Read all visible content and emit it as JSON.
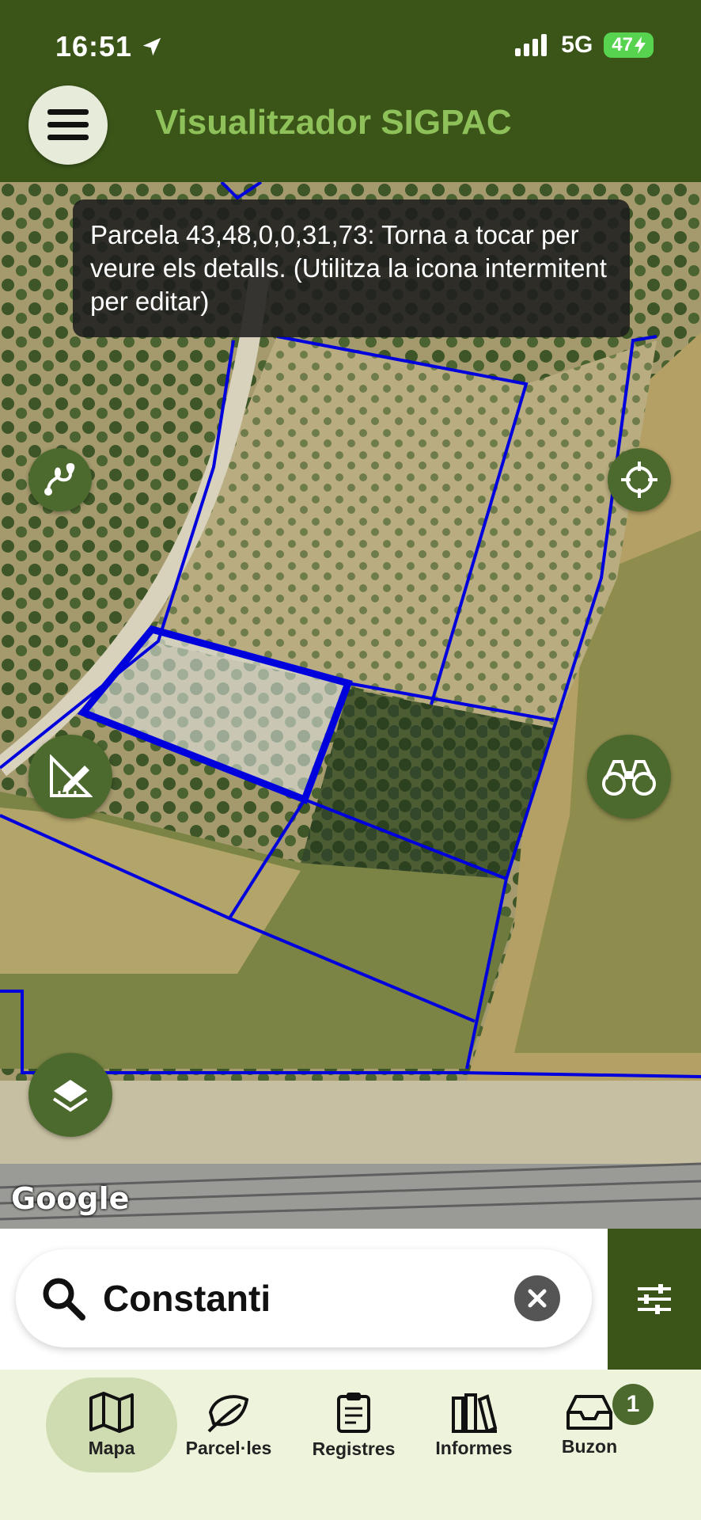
{
  "status_bar": {
    "time": "16:51",
    "network": "5G",
    "battery": "47"
  },
  "header": {
    "title": "Visualitzador SIGPAC"
  },
  "map": {
    "toast_message": "Parcela 43,48,0,0,31,73: Torna a tocar per veure els detalls. (Utilitza la icona intermitent per editar)",
    "attribution": "Google"
  },
  "search": {
    "query": "Constanti"
  },
  "bottom_nav": {
    "items": [
      {
        "label": "Mapa",
        "icon": "map-icon",
        "active": true
      },
      {
        "label": "Parcel·les",
        "icon": "leaf-icon",
        "active": false
      },
      {
        "label": "Registres",
        "icon": "clipboard-icon",
        "active": false
      },
      {
        "label": "Informes",
        "icon": "books-icon",
        "active": false
      },
      {
        "label": "Buzon",
        "icon": "inbox-icon",
        "active": false
      }
    ],
    "inbox_badge": "1"
  },
  "colors": {
    "header": "#3b5519",
    "title": "#8fc15a",
    "button": "#4d6a2e",
    "parcel_lines": "#0000dd",
    "nav_bg": "#eef4dc",
    "nav_active": "#cfdcb1"
  }
}
